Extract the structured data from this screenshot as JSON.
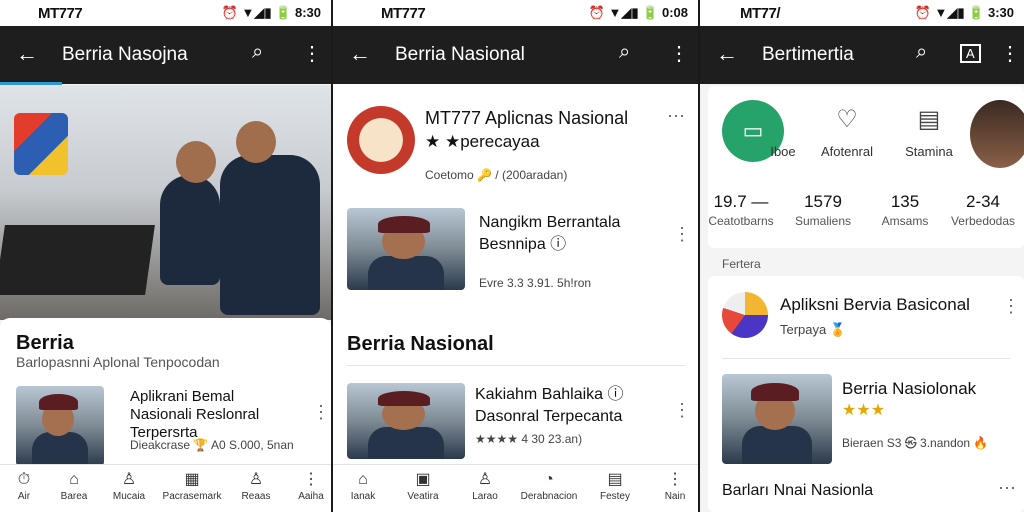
{
  "phone1": {
    "status": {
      "carrier": "MT777",
      "icons": "⏰ ▼◢▮ 🔋 8:30"
    },
    "appbar": {
      "title": "Berria Nasojna"
    },
    "card": {
      "title": "Berria",
      "subtitle": "Barlopasnni Aplonal Tenpocodan"
    },
    "item": {
      "title": "Aplikrani Bemal Nasionali Reslonral Terpersrta",
      "meta": "Dieakcrase 🏆 A0 S.000, 5nan"
    },
    "nav": [
      {
        "icon": "⏱",
        "label": "Air"
      },
      {
        "icon": "⌂",
        "label": "Barea"
      },
      {
        "icon": "♙",
        "label": "Mucaia"
      },
      {
        "icon": "▦",
        "label": "Pacrasemark"
      },
      {
        "icon": "♙",
        "label": "Reaas"
      },
      {
        "icon": "⋮",
        "label": "Aaiha"
      }
    ]
  },
  "phone2": {
    "status": {
      "carrier": "MT777",
      "icons": "⏰ ▼◢▮ 🔋 0:08"
    },
    "appbar": {
      "title": "Berria Nasional"
    },
    "app": {
      "title": "MT777 Aplicnas Nasional",
      "rating": "★ ★perecayaa",
      "meta": "Coetomo 🔑 / (200aradan)"
    },
    "item1": {
      "title": "Nangikm Berrantala Besnnipa ⓘ",
      "meta": "Evre 3.3 3.91. 5h!ron"
    },
    "section": "Berria Nasional",
    "item2": {
      "title": "Kakiahm Bahlaika ⓘ Dasonral Terpecanta",
      "meta": "★★★★ 4 30 23.an)"
    },
    "nav": [
      {
        "icon": "⌂",
        "label": "Ianak"
      },
      {
        "icon": "▣",
        "label": "Veatira"
      },
      {
        "icon": "♙",
        "label": "Larao"
      },
      {
        "icon": "◔",
        "label": "Derabnacion"
      },
      {
        "icon": "▤",
        "label": "Festey"
      },
      {
        "icon": "⋮",
        "label": "Nain"
      }
    ]
  },
  "phone3": {
    "status": {
      "carrier": "MT77/",
      "icons": "⏰ ▼◢▮ 🔋 3:30"
    },
    "appbar": {
      "title": "Bertimertia"
    },
    "chips": [
      {
        "icon": "▭",
        "label": "Iboe",
        "color": "#26a36b"
      },
      {
        "icon": "♡",
        "label": "Afotenral",
        "color": "#ffffff"
      },
      {
        "icon": "▤",
        "label": "Stamina",
        "color": "#ffffff"
      }
    ],
    "stats": [
      {
        "value": "19.7 —",
        "label": "Ceatotbarns"
      },
      {
        "value": "1579",
        "label": "Sumaliens"
      },
      {
        "value": "135",
        "label": "Amsams"
      },
      {
        "value": "2-34",
        "label": "Verbedodas"
      }
    ],
    "section": "Fertera",
    "app": {
      "title": "Apliksni Bervia Basiconal",
      "rating": "Terpaya 🏅"
    },
    "item": {
      "title": "Berria Nasiolonak",
      "stars": "★★★",
      "meta": "Bieraen S3 ㉿ 3.nandon 🔥"
    },
    "footer": "Barları Nnai Nasionla"
  }
}
